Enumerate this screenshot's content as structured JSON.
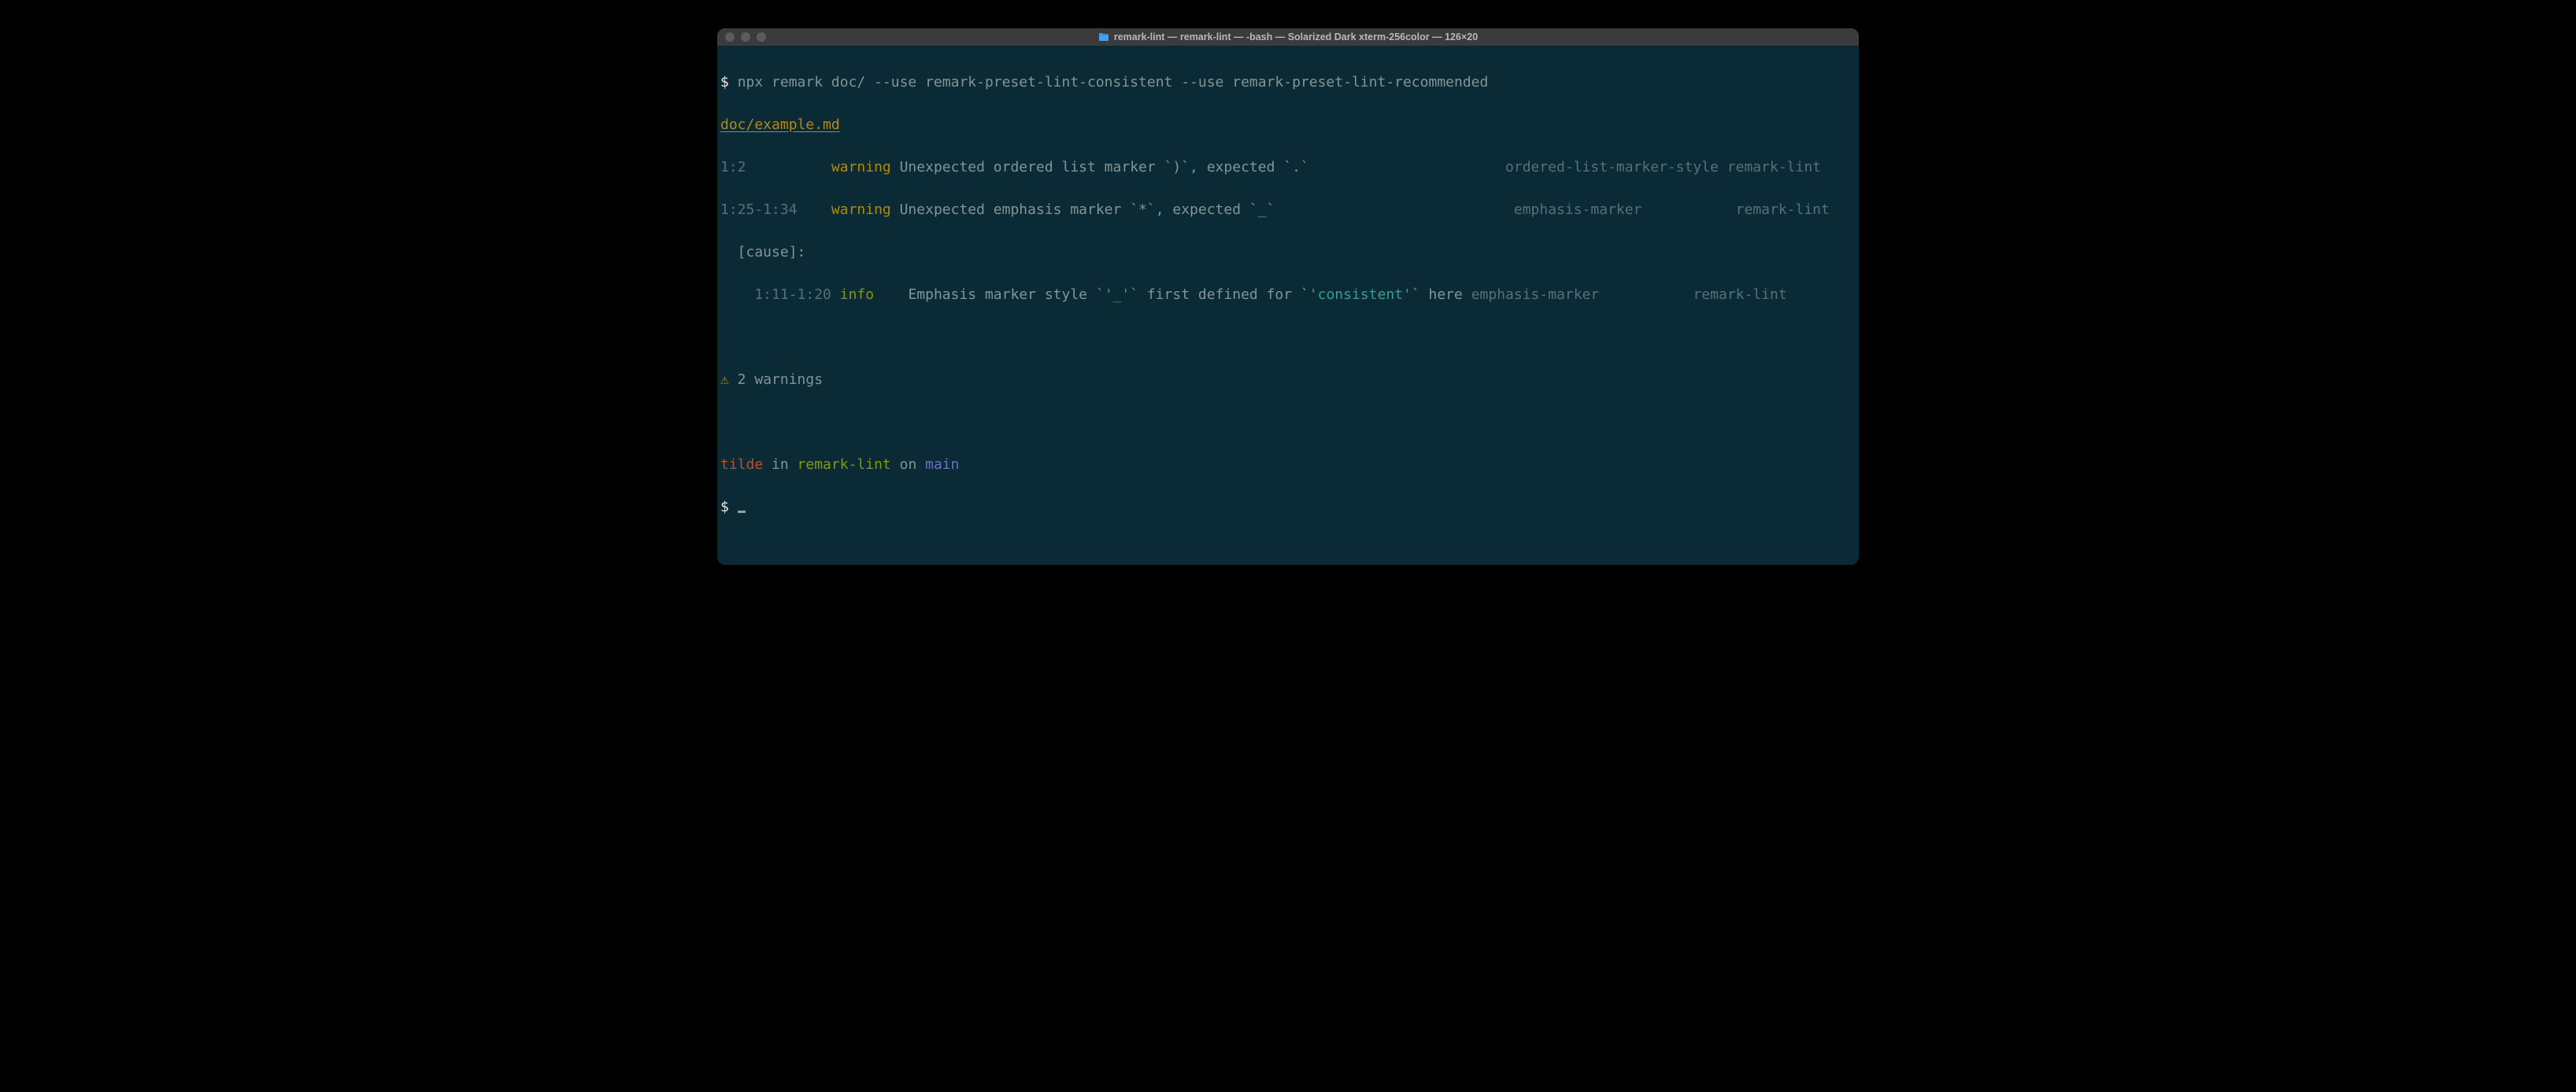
{
  "window": {
    "title": "remark-lint — remark-lint — -bash — Solarized Dark xterm-256color — 126×20"
  },
  "prompt1": {
    "sym": "$ ",
    "cmd": "npx remark doc/ --use remark-preset-lint-consistent --use remark-preset-lint-recommended"
  },
  "file": "doc/example.md",
  "lines": {
    "l1": {
      "pos": "1:2          ",
      "sev": "warning",
      "sp1": " ",
      "msg": "Unexpected ordered list marker `)`, expected `.`                       ",
      "rule": "ordered-list-marker-style",
      "sp2": " ",
      "src": "remark-lint"
    },
    "l2": {
      "pos": "1:25-1:34    ",
      "sev": "warning",
      "sp1": " ",
      "msg": "Unexpected emphasis marker `*`, expected `_`                            ",
      "rule": "emphasis-marker          ",
      "sp2": " ",
      "src": "remark-lint"
    },
    "cause": "  [cause]:",
    "l3": {
      "pos": "    1:11-1:20",
      "sp0": " ",
      "sev": "info   ",
      "sp1": " ",
      "msg1": "Emphasis marker style `",
      "q1": "'_'",
      "msg2": "` first defined for `",
      "q2": "'consistent'",
      "msg3": "` here ",
      "rule": "emphasis-marker          ",
      "sp2": " ",
      "src": "remark-lint"
    }
  },
  "summary": {
    "icon": "⚠",
    "text": " 2 warnings"
  },
  "status": {
    "host": "tilde",
    "sep1": " in ",
    "dir": "remark-lint",
    "sep2": " on ",
    "branch": "main"
  },
  "prompt2": "$ "
}
